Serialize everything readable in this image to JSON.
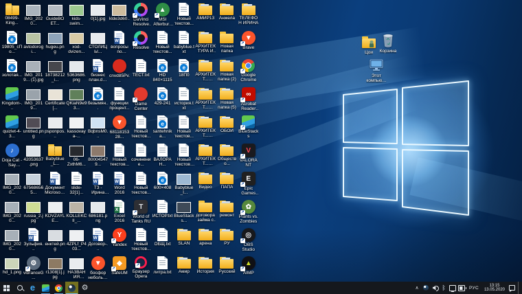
{
  "colors": {
    "wall_base": "#072a55",
    "wall_glow": "#9fd8ff",
    "taskbar": "#15181d",
    "accent_running": "#5ea0d8",
    "active_button_bg": "#74711f",
    "label_text": "#ffffff"
  },
  "desktop": {
    "free_icons": {
      "user_folder": "Цои",
      "recycle_bin": "Корзина",
      "this_pc": "Этот компьютер"
    },
    "grid_icons": [
      {
        "l": "08499-King...",
        "t": "zip"
      },
      {
        "l": "IMG_2020...",
        "t": "photo",
        "bg": "#aab3bc"
      },
      {
        "l": "GuideВОЕТ...",
        "t": "photo",
        "bg": "#b5bcc3"
      },
      {
        "l": "kids-swim...",
        "t": "photo",
        "bg": "#9cc98f"
      },
      {
        "l": "0[1].jpg",
        "t": "photo",
        "bg": "#e6eaee"
      },
      {
        "l": "klde3d60...",
        "t": "photo",
        "bg": "#cdbc9e"
      },
      {
        "l": "DaVinci Resolve Pro...",
        "t": "davinci",
        "n": "davinci-resolve",
        "sc": 1
      },
      {
        "l": "MSI Afterburner",
        "t": "app",
        "n": "msi-afterburner",
        "bg": "#2f8f46",
        "g": "▲",
        "sc": 1
      },
      {
        "l": "Новый текстов...",
        "t": "doc"
      },
      {
        "l": "АМИР13",
        "t": "folder-img"
      },
      {
        "l": "Анжела",
        "t": "folder-img"
      },
      {
        "l": "ТЕЛЕФОН ИРИНА",
        "t": "folder-img"
      },
      {
        "l": "19805_сПо...",
        "t": "epdf"
      },
      {
        "l": "avtodorogi...",
        "t": "photo",
        "bg": "#b9c4a4"
      },
      {
        "l": "hugeu.png",
        "t": "photo",
        "bg": "#8ea4ba"
      },
      {
        "l": "xod-dvizen...",
        "t": "photo",
        "bg": "#d8cba6"
      },
      {
        "l": "СТОЛИЦЫ...",
        "t": "photo",
        "bg": "#e7eaed"
      },
      {
        "l": "вопросы по истории...",
        "t": "word"
      },
      {
        "l": "Resolve",
        "t": "davinci",
        "n": "davinci-resolve",
        "sc": 1
      },
      {
        "l": "Новый текстов...",
        "t": "doc"
      },
      {
        "l": "babyblue.txt",
        "t": "doc"
      },
      {
        "l": "АРХИТЕКТУРА И СКУЛЬП...",
        "t": "folder-img"
      },
      {
        "l": "Новая папка",
        "t": "folder"
      },
      {
        "l": "Brave",
        "t": "app",
        "n": "brave",
        "bg": "#fb542b",
        "g": "▼",
        "sc": 1
      },
      {
        "l": "золотая...",
        "t": "epdf"
      },
      {
        "l": "IMG_2019... (1).jpg",
        "t": "photo",
        "bg": "#a9b1b9"
      },
      {
        "l": "18738212_i...",
        "t": "photo",
        "bg": "#46474c"
      },
      {
        "l": "5363686.png",
        "t": "photo",
        "bg": "#e3e8ec"
      },
      {
        "l": "бизнес план.docx",
        "t": "word"
      },
      {
        "l": "cnvd85Pv...",
        "t": "app",
        "n": "media-player",
        "bg": "#d92b1e",
        "g": ""
      },
      {
        "l": "ТЕСТ.txt",
        "t": "doc"
      },
      {
        "l": "HD 840×1115",
        "t": "epdf"
      },
      {
        "l": "18П0",
        "t": "epdf"
      },
      {
        "l": "АРХИТЕКТ... РОССИИ И...",
        "t": "folder-img"
      },
      {
        "l": "Новая папка (2)",
        "t": "folder-img"
      },
      {
        "l": "Google Chrome",
        "t": "chrome",
        "n": "chrome",
        "sc": 1
      },
      {
        "l": "Kingdom-...",
        "t": "bluestacks",
        "n": "bluestacks-apk"
      },
      {
        "l": "IMG_2019...",
        "t": "photo",
        "bg": "#9aa3ab"
      },
      {
        "l": "Certificate[...",
        "t": "photo",
        "bg": "#e9e3d7"
      },
      {
        "l": "QKiaN9e93...",
        "t": "photo",
        "bg": "#60805a"
      },
      {
        "l": "безымян...",
        "t": "epdf"
      },
      {
        "l": "функции процент...",
        "t": "doc"
      },
      {
        "l": "Game Center",
        "t": "app",
        "n": "game-center",
        "bg": "#e23a2e",
        "g": "",
        "sc": 1
      },
      {
        "l": "429-241",
        "t": "epdf"
      },
      {
        "l": "история.txt",
        "t": "doc"
      },
      {
        "l": "АРХИТЕКТ... ВЛАДИМИР",
        "t": "folder-img"
      },
      {
        "l": "Новая папка (5)",
        "t": "folder-img"
      },
      {
        "l": "Acrobat Reader DC",
        "t": "app",
        "n": "acrobat-reader",
        "bg": "#c00c00",
        "g": "∞",
        "shape": "square",
        "sc": 1
      },
      {
        "l": "quizlet-4-3...",
        "t": "bluestacks",
        "n": "bluestacks-apk"
      },
      {
        "l": "untitled.png",
        "t": "photo",
        "bg": "#514c55"
      },
      {
        "l": "psponpos...",
        "t": "photo",
        "bg": "#e8ebee"
      },
      {
        "l": "kassovaya-...",
        "t": "photo",
        "bg": "#eff1f3"
      },
      {
        "l": "BqbnsM0...",
        "t": "photo",
        "bg": "#cfe2f4"
      },
      {
        "l": "6811815328...",
        "t": "app",
        "n": "brave-html",
        "bg": "#fb542b",
        "g": "▼"
      },
      {
        "l": "Новый текстов...",
        "t": "doc"
      },
      {
        "l": "santehnika...",
        "t": "epdf"
      },
      {
        "l": "Новый текстов...",
        "t": "doc"
      },
      {
        "l": "АРХИТЕКТ... НОВГОРОД",
        "t": "folder-img"
      },
      {
        "l": "ОБОИ",
        "t": "folder-img"
      },
      {
        "l": "BlueStacks",
        "t": "bluestacks",
        "n": "bluestacks",
        "sc": 1
      },
      {
        "l": "Doja Cat - Say So.mp3",
        "t": "app",
        "n": "audio-file",
        "bg": "#2c6fd0",
        "g": "♪"
      },
      {
        "l": "42053637.png",
        "t": "photo",
        "bg": "#dde2e8"
      },
      {
        "l": "Babyblue_L...",
        "t": "zip"
      },
      {
        "l": "06-ZxthM6...",
        "t": "photo",
        "bg": "#26292e"
      },
      {
        "l": "800045479...",
        "t": "photo",
        "bg": "#8d7a6c"
      },
      {
        "l": "Новый текстов...",
        "t": "doc"
      },
      {
        "l": "сочинение...",
        "t": "doc"
      },
      {
        "l": "ВАЛОРАН...",
        "t": "doc"
      },
      {
        "l": "Новый текстовый...",
        "t": "doc"
      },
      {
        "l": "АРХИТЕКТ... СКУЛЬПТУ...",
        "t": "folder-img"
      },
      {
        "l": "Общество...",
        "t": "folder-img"
      },
      {
        "l": "VALORANT",
        "t": "app",
        "n": "valorant",
        "bg": "#1a1a1e",
        "g": "V",
        "fg": "#ff4655",
        "shape": "square",
        "sc": 1
      },
      {
        "l": "IMG_2020...",
        "t": "photo",
        "bg": "#a7b0b8"
      },
      {
        "l": "675686565...",
        "t": "photo",
        "bg": "#c7d2dc"
      },
      {
        "l": "Документ Microsoft...",
        "t": "word"
      },
      {
        "l": "slide-32[1]...",
        "t": "doc"
      },
      {
        "l": "ТЗ - Ирина ПЦ.docx",
        "t": "word"
      },
      {
        "l": "Word 2016",
        "t": "word",
        "n": "word-2016",
        "sc": 1
      },
      {
        "l": "Новый текстов...",
        "t": "doc"
      },
      {
        "l": "600×408",
        "t": "epdf"
      },
      {
        "l": "Babyblue_I...",
        "t": "photo",
        "bg": "#9db9d3"
      },
      {
        "l": "Видео",
        "t": "folder-img"
      },
      {
        "l": "ПАПА",
        "t": "folder-img"
      },
      {
        "l": "Epic Games Launcher",
        "t": "app",
        "n": "epic-games",
        "bg": "#202020",
        "g": "E",
        "shape": "square",
        "sc": 1
      },
      {
        "l": "IMG_2020...",
        "t": "photo",
        "bg": "#a7b0b8"
      },
      {
        "l": "russia_2.jpg",
        "t": "photo",
        "bg": "#cfdd94"
      },
      {
        "l": "KDVZAYLE...",
        "t": "photo",
        "bg": "#eceff1"
      },
      {
        "l": "KOLLEKCII_...",
        "t": "photo",
        "bg": "#bcb4a6"
      },
      {
        "l": "686181.png",
        "t": "photo",
        "bg": "#e5e9ec"
      },
      {
        "l": "Excel 2016",
        "t": "excel",
        "n": "excel-2016",
        "sc": 1
      },
      {
        "l": "World of Tanks RU",
        "t": "app",
        "n": "world-of-tanks",
        "bg": "#2e2f34",
        "g": "T",
        "fg": "#e0e3e7",
        "shape": "square",
        "sc": 1
      },
      {
        "l": "ИСТОР.txt",
        "t": "doc"
      },
      {
        "l": "BlueStacks...",
        "t": "photo",
        "bg": "#3e4a58"
      },
      {
        "l": "договора займа с о...",
        "t": "folder"
      },
      {
        "l": "ремонт",
        "t": "folder-img"
      },
      {
        "l": "Plants vs. Zombies",
        "t": "app",
        "n": "plants-vs-zombies",
        "bg": "#56893c",
        "g": "✿",
        "sc": 1
      },
      {
        "l": "IMG_2020...",
        "t": "photo",
        "bg": "#a7b0b8"
      },
      {
        "l": "Зульфия...",
        "t": "word"
      },
      {
        "l": "енктей.png",
        "t": "photo",
        "bg": "#d9dde1"
      },
      {
        "l": "4ZPLf_P403...",
        "t": "photo",
        "bg": "#eef0f2"
      },
      {
        "l": "Договор-...",
        "t": "word"
      },
      {
        "l": "Yandex",
        "t": "app",
        "n": "yandex-browser",
        "bg": "#fc3f1d",
        "g": "Y",
        "sc": 1
      },
      {
        "l": "Новый текстов...",
        "t": "doc"
      },
      {
        "l": "ОБЩ.txt",
        "t": "doc"
      },
      {
        "l": "SLAN",
        "t": "folder-img"
      },
      {
        "l": "арена",
        "t": "folder-img"
      },
      {
        "l": "РУ",
        "t": "folder-img"
      },
      {
        "l": "OBS Studio",
        "t": "app",
        "n": "obs-studio",
        "bg": "#17181c",
        "g": "◎",
        "fg": "#e8eaee",
        "sc": 1
      },
      {
        "l": "hd_1.png",
        "t": "photo",
        "bg": "#ccd5b9"
      },
      {
        "l": "vibranceG...",
        "t": "app",
        "n": "vibrance-gui",
        "bg": "#5b6b7d",
        "g": "⚙",
        "sc": 1
      },
      {
        "l": "r1308[1].jpg",
        "t": "photo",
        "bg": "#8d7a63"
      },
      {
        "l": "НАЗВАНИЯ РОССИИ.jpg",
        "t": "photo",
        "bg": "#e9ecef"
      },
      {
        "l": "босфор небольш...",
        "t": "app",
        "n": "brave-html",
        "bg": "#fb542b",
        "g": "▼"
      },
      {
        "l": "SafeUM",
        "t": "app",
        "n": "safeum",
        "bg": "#f59a23",
        "g": "◆",
        "shape": "square",
        "sc": 1
      },
      {
        "l": "Браузер Opera",
        "t": "opera",
        "n": "opera",
        "sc": 1
      },
      {
        "l": "литра.txt",
        "t": "doc"
      },
      {
        "l": "Амир",
        "t": "folder-img"
      },
      {
        "l": "История",
        "t": "folder-img"
      },
      {
        "l": "Русский",
        "t": "folder-img"
      },
      {
        "l": "AIMP",
        "t": "app",
        "n": "aimp",
        "bg": "#101014",
        "g": "▲",
        "fg": "#cddc29",
        "sc": 1
      }
    ]
  },
  "taskbar": {
    "items": [
      {
        "name": "start",
        "running": false,
        "active": false
      },
      {
        "name": "search",
        "running": false,
        "active": false
      },
      {
        "name": "edge",
        "running": false,
        "active": false
      },
      {
        "name": "bluestacks",
        "running": true,
        "active": false
      },
      {
        "name": "chrome",
        "running": true,
        "active": false
      },
      {
        "name": "steam",
        "running": true,
        "active": true
      },
      {
        "name": "settings",
        "running": false,
        "active": false
      }
    ],
    "tray": {
      "chevron": "∧",
      "icons": [
        "steam",
        "volume",
        "bluetooth",
        "display",
        "battery"
      ],
      "language": "РУС",
      "time": "13:15",
      "date": "13.05.2020"
    }
  }
}
